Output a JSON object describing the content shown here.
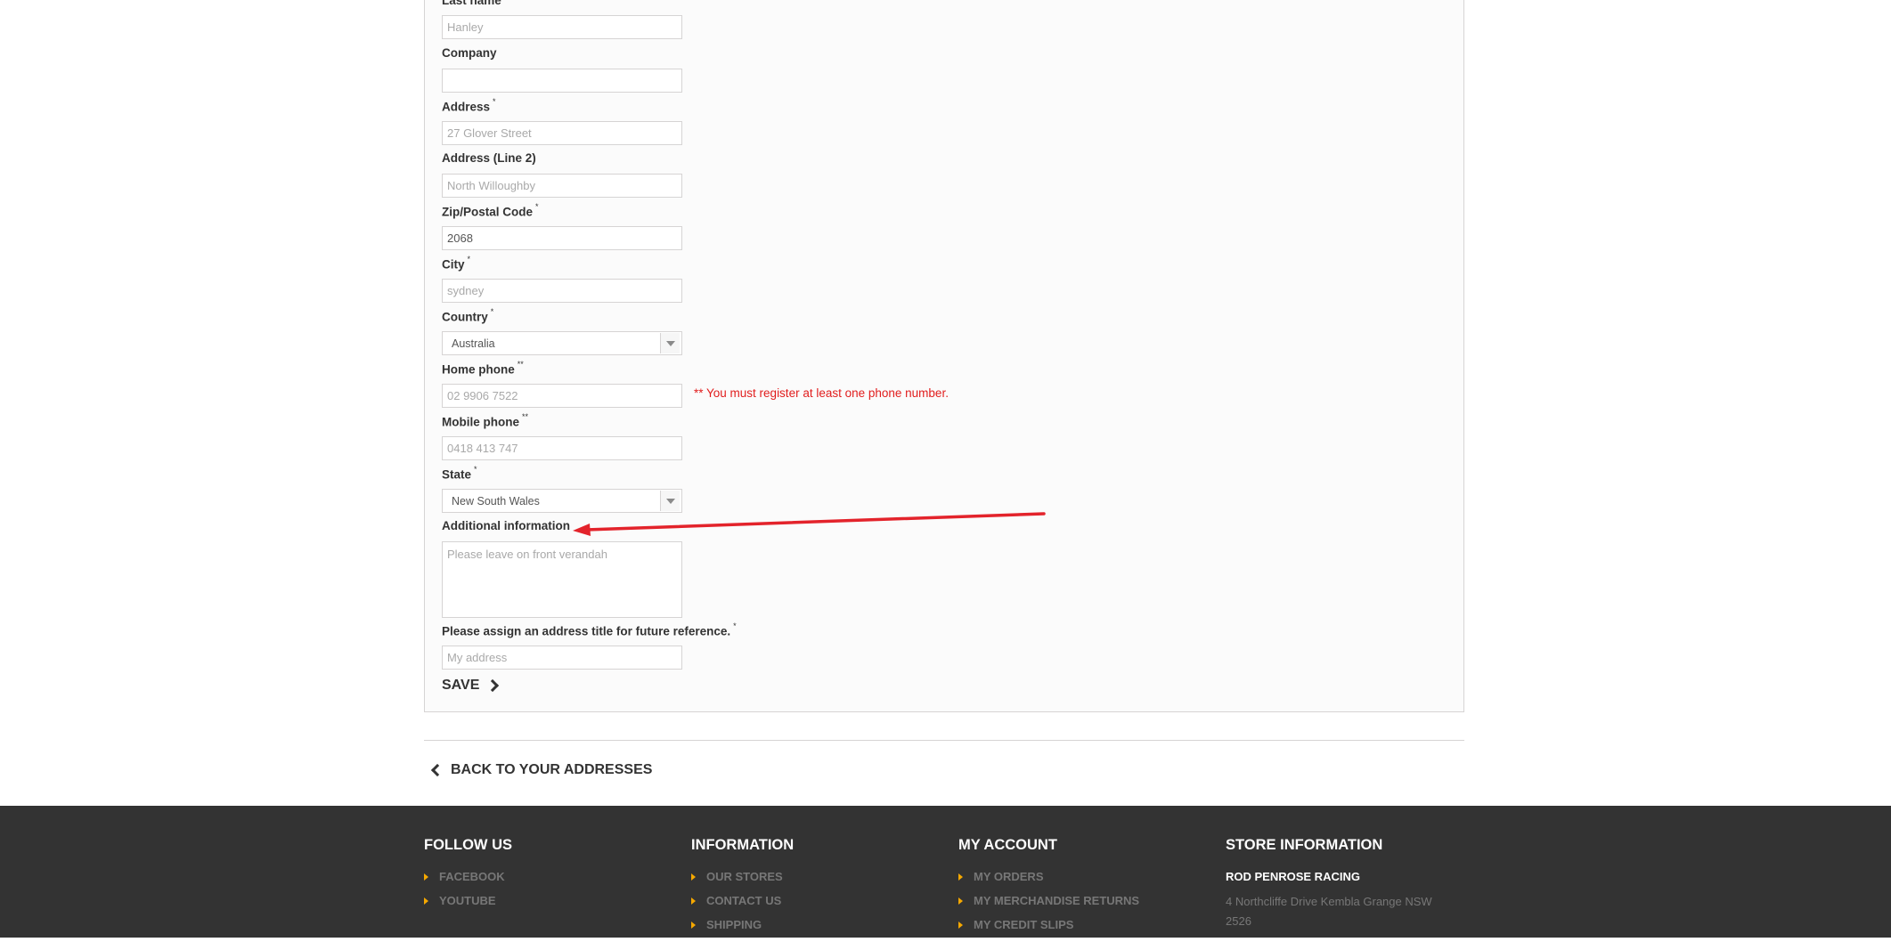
{
  "form": {
    "last_name": {
      "label": "Last name",
      "placeholder": "Hanley"
    },
    "company": {
      "label": "Company",
      "value": ""
    },
    "address": {
      "label": "Address",
      "required": "*",
      "placeholder": "27 Glover Street"
    },
    "address2": {
      "label": "Address (Line 2)",
      "placeholder": "North Willoughby"
    },
    "postcode": {
      "label": "Zip/Postal Code",
      "required": "*",
      "value": "2068"
    },
    "city": {
      "label": "City",
      "required": "*",
      "placeholder": "sydney"
    },
    "country": {
      "label": "Country",
      "required": "*",
      "selected": "Australia"
    },
    "home_phone": {
      "label": "Home phone",
      "required": "**",
      "placeholder": "02 9906 7522"
    },
    "phone_note": "** You must register at least one phone number.",
    "mobile_phone": {
      "label": "Mobile phone",
      "required": "**",
      "placeholder": "0418 413 747"
    },
    "state": {
      "label": "State",
      "required": "*",
      "selected": "New South Wales"
    },
    "additional_info": {
      "label": "Additional information",
      "placeholder": "Please leave on front verandah"
    },
    "alias": {
      "label": "Please assign an address title for future reference.",
      "required": "*",
      "placeholder": "My address"
    },
    "save_label": "SAVE"
  },
  "back_link": "BACK TO YOUR ADDRESSES",
  "annotation": {
    "color": "#e3232b",
    "icon": "red-arrow-annotation"
  },
  "footer": {
    "follow": {
      "title": "FOLLOW US",
      "items": [
        "FACEBOOK",
        "YOUTUBE"
      ]
    },
    "information": {
      "title": "INFORMATION",
      "items": [
        "OUR STORES",
        "CONTACT US",
        "SHIPPING"
      ]
    },
    "account": {
      "title": "MY ACCOUNT",
      "items": [
        "MY ORDERS",
        "MY MERCHANDISE RETURNS",
        "MY CREDIT SLIPS"
      ]
    },
    "store": {
      "title": "STORE INFORMATION",
      "name": "ROD PENROSE RACING",
      "address": "4 Northcliffe Drive Kembla Grange NSW 2526"
    }
  },
  "colors": {
    "footer_bg": "#333333",
    "bullet": "#f5a800",
    "error": "#e11d1d"
  }
}
